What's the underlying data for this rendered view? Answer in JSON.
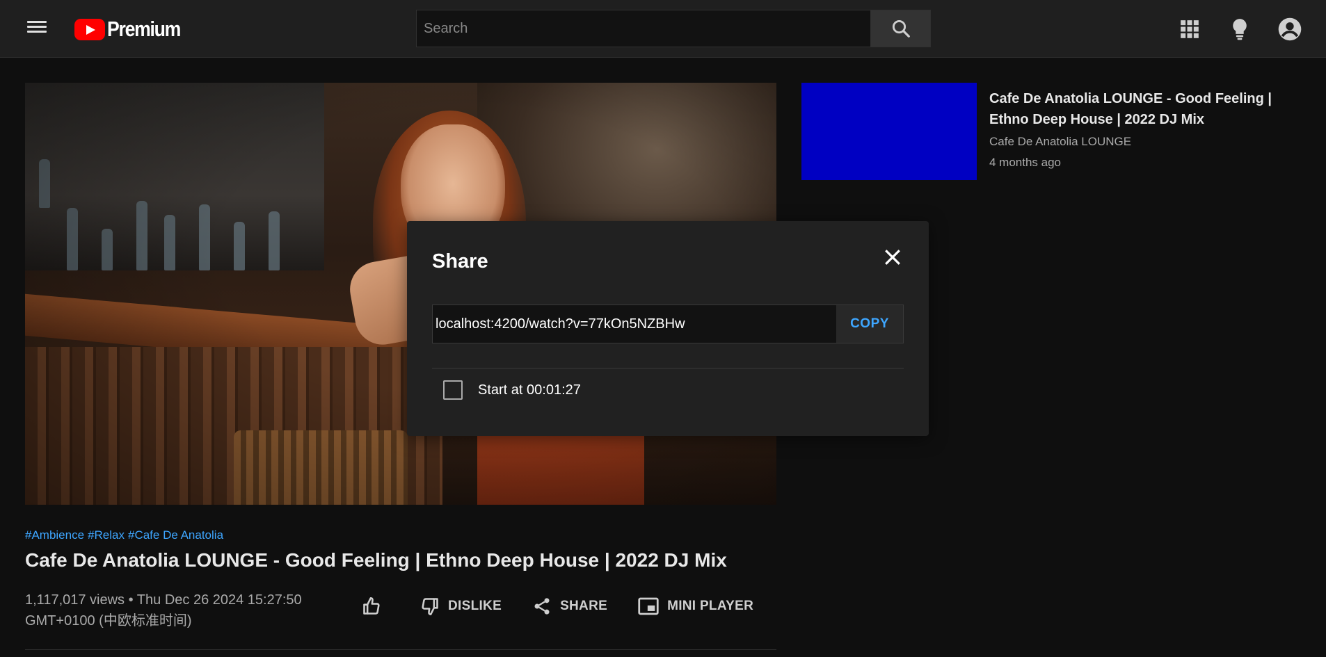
{
  "app": {
    "logo_text": "Premium",
    "accent_color": "#3ea6ff",
    "brand_color": "#ff0000"
  },
  "header": {
    "search_placeholder": "Search",
    "icons": [
      "menu-icon",
      "search-icon",
      "apps-grid-icon",
      "lightbulb-icon",
      "account-icon"
    ]
  },
  "video": {
    "tags": [
      "#Ambience",
      "#Relax",
      "#Cafe De Anatolia"
    ],
    "title": "Cafe De Anatolia LOUNGE - Good Feeling | Ethno Deep House | 2022 DJ Mix",
    "meta_line1": "1,117,017 views • Thu Dec 26 2024 15:27:50",
    "meta_line2": "GMT+0100 (中欧标准时间)",
    "actions": {
      "dislike": "DISLIKE",
      "share": "SHARE",
      "mini_player": "MINI PLAYER"
    }
  },
  "sidebar": {
    "recommendations": [
      {
        "title": "Cafe De Anatolia LOUNGE - Good Feeling | Ethno Deep House | 2022 DJ Mix",
        "channel": "Cafe De Anatolia LOUNGE",
        "age": "4 months ago",
        "thumb_color": "#0000c2"
      }
    ]
  },
  "share_dialog": {
    "title": "Share",
    "url": "localhost:4200/watch?v=77kOn5NZBHw",
    "copy_label": "COPY",
    "start_at_label": "Start at 00:01:27",
    "start_at_checked": false
  }
}
